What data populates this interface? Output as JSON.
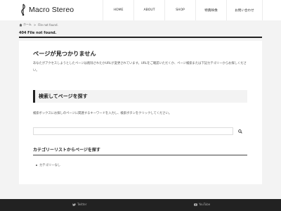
{
  "site": {
    "title": "Macro Stereo"
  },
  "nav": {
    "items": [
      "HOME",
      "ABOUT",
      "SHOP",
      "特典映像",
      "お問い合わせ"
    ]
  },
  "breadcrumb": {
    "home": "ホーム",
    "current": "File not found."
  },
  "page": {
    "title": "404 File not found."
  },
  "content": {
    "heading": "ページが見つかりません",
    "description": "あなたがアクセスしようとしたページは削除されたかURLが変更されています。URLをご確認いただくか、ページ検索または下記カテゴリーからお探しください。",
    "search_heading": "検索してページを探す",
    "search_text": "検索ボックスにお探しのページに関連するキーワードを入力し、検索ボタンをクリックしてください。",
    "search_placeholder": "",
    "category_heading": "カテゴリーリストからページを探す",
    "category_items": [
      "カテゴリーなし"
    ]
  },
  "footer": {
    "twitter": "Twitter",
    "youtube": "YouTube"
  }
}
